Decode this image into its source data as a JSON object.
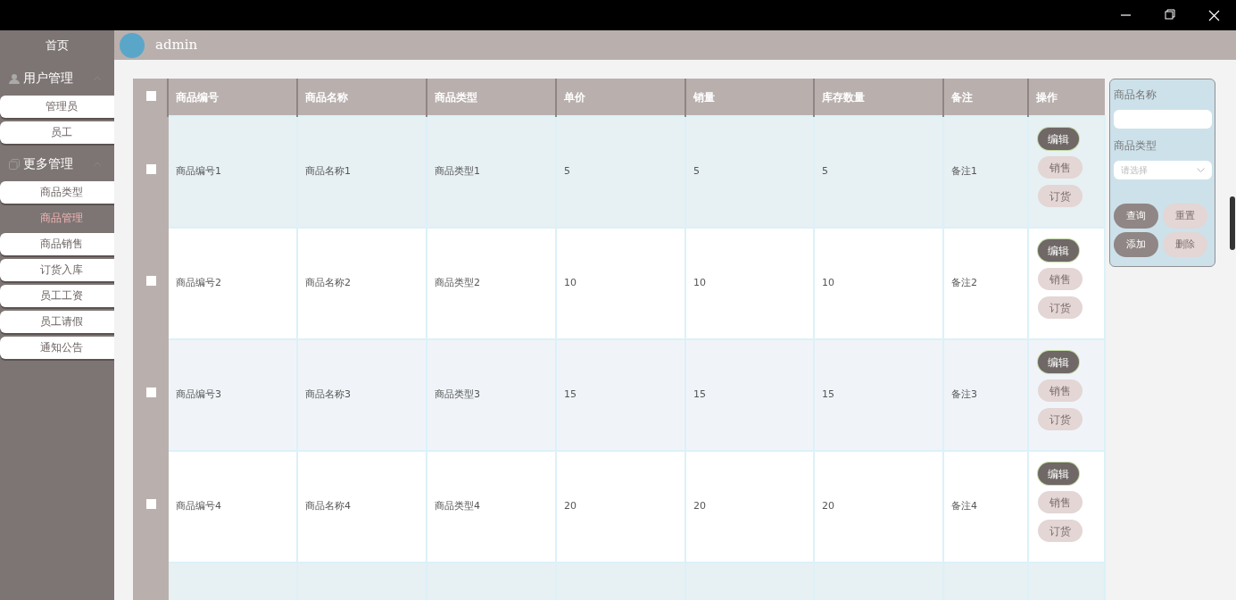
{
  "sidebar": {
    "home": "首页",
    "groups": [
      {
        "title": "用户管理",
        "expanded": true,
        "items": [
          {
            "label": "管理员",
            "selected": false
          },
          {
            "label": "员工",
            "selected": false
          }
        ]
      },
      {
        "title": "更多管理",
        "expanded": true,
        "items": [
          {
            "label": "商品类型",
            "selected": false
          },
          {
            "label": "商品管理",
            "selected": true
          },
          {
            "label": "商品销售",
            "selected": false
          },
          {
            "label": "订货入库",
            "selected": false
          },
          {
            "label": "员工工资",
            "selected": false
          },
          {
            "label": "员工请假",
            "selected": false
          },
          {
            "label": "通知公告",
            "selected": false
          }
        ]
      }
    ]
  },
  "header": {
    "user": "admin"
  },
  "table": {
    "select_all": false,
    "columns": [
      "商品编号",
      "商品名称",
      "商品类型",
      "单价",
      "销量",
      "库存数量",
      "备注",
      "操作"
    ],
    "rows": [
      {
        "checked": false,
        "cells": [
          "商品编号1",
          "商品名称1",
          "商品类型1",
          "5",
          "5",
          "5",
          "备注1"
        ],
        "actions": [
          {
            "label": "编辑",
            "disabled": false
          },
          {
            "label": "销售",
            "disabled": true
          },
          {
            "label": "订货",
            "disabled": true
          }
        ]
      },
      {
        "checked": false,
        "cells": [
          "商品编号2",
          "商品名称2",
          "商品类型2",
          "10",
          "10",
          "10",
          "备注2"
        ],
        "actions": [
          {
            "label": "编辑",
            "disabled": false
          },
          {
            "label": "销售",
            "disabled": true
          },
          {
            "label": "订货",
            "disabled": true
          }
        ]
      },
      {
        "checked": false,
        "cells": [
          "商品编号3",
          "商品名称3",
          "商品类型3",
          "15",
          "15",
          "15",
          "备注3"
        ],
        "actions": [
          {
            "label": "编辑",
            "disabled": false
          },
          {
            "label": "销售",
            "disabled": true
          },
          {
            "label": "订货",
            "disabled": true
          }
        ]
      },
      {
        "checked": false,
        "cells": [
          "商品编号4",
          "商品名称4",
          "商品类型4",
          "20",
          "20",
          "20",
          "备注4"
        ],
        "actions": [
          {
            "label": "编辑",
            "disabled": false
          },
          {
            "label": "销售",
            "disabled": true
          },
          {
            "label": "订货",
            "disabled": true
          }
        ]
      }
    ]
  },
  "filter": {
    "name_label": "商品名称",
    "type_label": "商品类型",
    "type_placeholder": "请选择",
    "buttons": [
      {
        "label": "查询",
        "disabled": false
      },
      {
        "label": "重置",
        "disabled": true
      },
      {
        "label": "添加",
        "disabled": false
      },
      {
        "label": "删除",
        "disabled": true
      }
    ]
  }
}
